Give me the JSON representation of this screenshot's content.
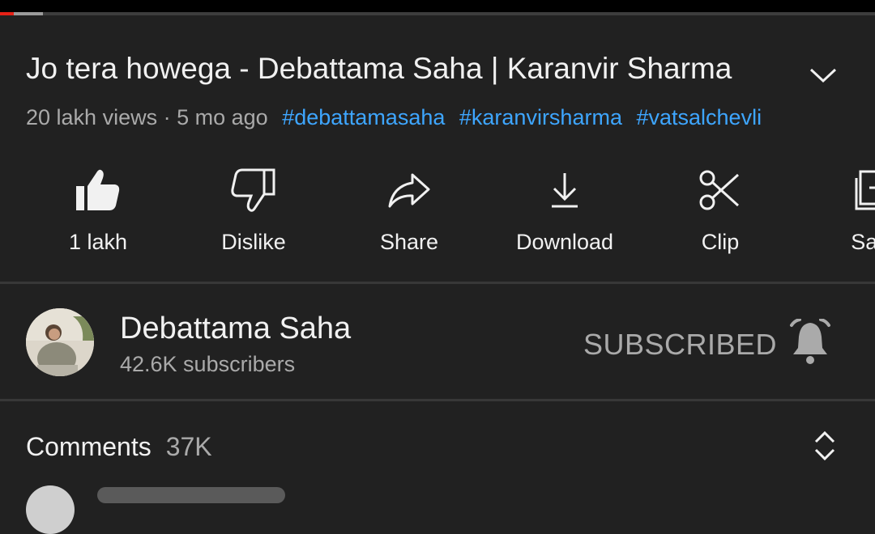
{
  "player": {
    "progress_played": 0.016,
    "progress_buffered": 0.049
  },
  "video": {
    "title": "Jo tera howega - Debattama Saha | Karanvir Sharma",
    "views": "20 lakh views",
    "separator": "·",
    "age": "5 mo ago",
    "hashtags": [
      "#debattamasaha",
      "#karanvirsharma",
      "#vatsalchevli"
    ]
  },
  "actions": [
    {
      "label": "1 lakh",
      "icon": "thumbs-up-filled-icon"
    },
    {
      "label": "Dislike",
      "icon": "thumbs-down-icon"
    },
    {
      "label": "Share",
      "icon": "share-icon"
    },
    {
      "label": "Download",
      "icon": "download-icon"
    },
    {
      "label": "Clip",
      "icon": "scissors-icon"
    },
    {
      "label": "Save",
      "icon": "save-to-playlist-icon"
    }
  ],
  "channel": {
    "name": "Debattama Saha",
    "subscribers": "42.6K subscribers",
    "subscribe_state": "SUBSCRIBED",
    "bell": "notification-bell-icon"
  },
  "comments": {
    "label": "Comments",
    "count": "37K"
  },
  "colors": {
    "background": "#212121",
    "hashtag": "#3ea6ff",
    "progress": "#e62117",
    "muted": "#aaaaaa"
  }
}
